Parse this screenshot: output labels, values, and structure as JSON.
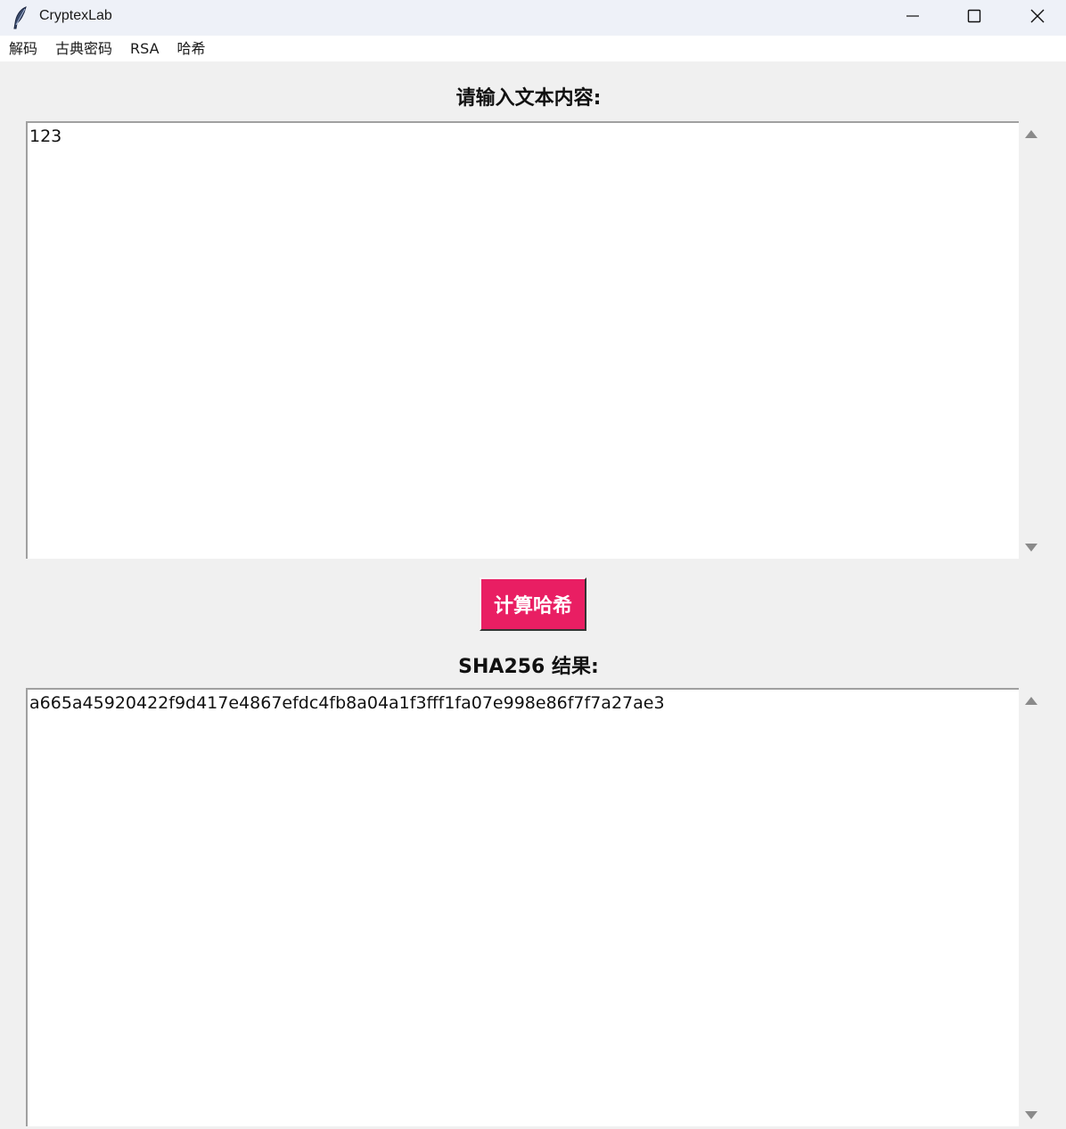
{
  "window": {
    "title": "CryptexLab",
    "app_icon": "feather-icon",
    "controls": {
      "minimize_icon": "minimize-icon",
      "maximize_icon": "maximize-icon",
      "close_icon": "close-icon"
    }
  },
  "menu": {
    "items": [
      {
        "label": "解码"
      },
      {
        "label": "古典密码"
      },
      {
        "label": "RSA"
      },
      {
        "label": "哈希"
      }
    ]
  },
  "input_section": {
    "heading": "请输入文本内容:",
    "text": "123"
  },
  "action": {
    "button_label": "计算哈希",
    "button_color": "#e91e63"
  },
  "result_section": {
    "heading": "SHA256 结果:",
    "text": "a665a45920422f9d417e4867efdc4fb8a04a1f3fff1fa07e998e86f7f7a27ae3"
  }
}
